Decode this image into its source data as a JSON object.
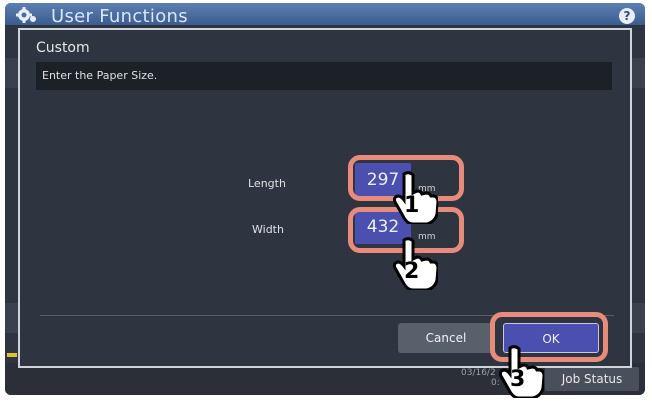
{
  "app": {
    "title": "User Functions",
    "help_label": "?"
  },
  "dialog": {
    "title": "Custom",
    "message": "Enter the Paper Size.",
    "length": {
      "label": "Length",
      "value": "297",
      "unit": "mm"
    },
    "width": {
      "label": "Width",
      "value": "432",
      "unit": "mm"
    },
    "cancel_label": "Cancel",
    "ok_label": "OK"
  },
  "status_bar": {
    "clock": "03/16/2",
    "clock_line2": "0:",
    "job_status_label": "Job Status"
  },
  "callouts": {
    "step1": "1",
    "step2": "2",
    "step3": "3"
  },
  "colors": {
    "accent": "#4a4fb0",
    "callout": "#e88b7a",
    "header": "#5d7fb2"
  },
  "icons": [
    "gear-icon",
    "help-icon",
    "hand-pointer-icon"
  ]
}
